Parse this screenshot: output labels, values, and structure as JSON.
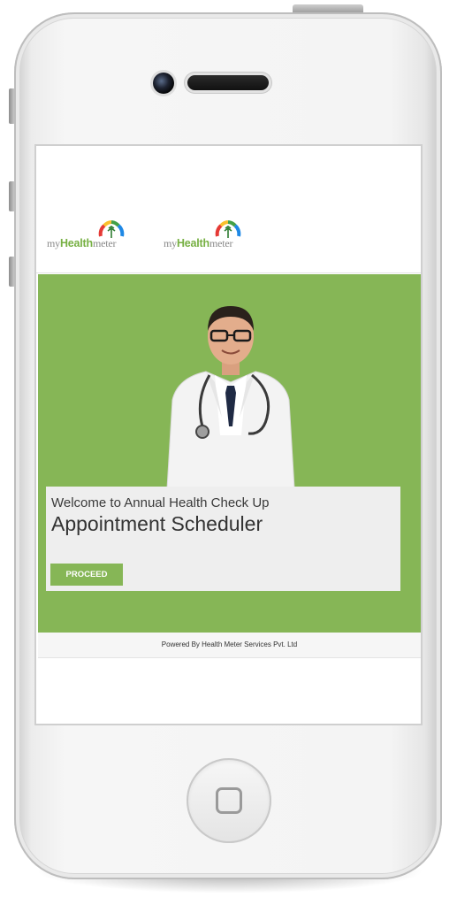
{
  "header": {
    "logo_left": {
      "prefix": "my",
      "strong": "Health",
      "suffix": "meter"
    },
    "logo_right": {
      "prefix": "my",
      "strong": "Health",
      "suffix": "meter"
    }
  },
  "hero": {
    "welcome_line": "Welcome to Annual Health Check Up",
    "title": "Appointment Scheduler",
    "proceed_label": "PROCEED"
  },
  "footer": {
    "text": "Powered By Health Meter Services Pvt. Ltd"
  },
  "colors": {
    "brand_green": "#86b656",
    "card_bg": "#eeeeee",
    "logo_green": "#77b043"
  },
  "icons": [
    "camera-icon",
    "speaker-icon",
    "home-button-icon",
    "health-gauge-icon",
    "doctor-image"
  ]
}
